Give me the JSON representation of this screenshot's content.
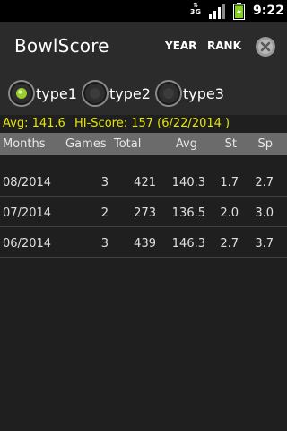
{
  "status_bar": {
    "network": "3G",
    "time": "9:22"
  },
  "action_bar": {
    "title": "BowlScore",
    "year_button": "YEAR",
    "rank_button": "RANK"
  },
  "types": [
    {
      "label": "type1",
      "selected": true
    },
    {
      "label": "type2",
      "selected": false
    },
    {
      "label": "type3",
      "selected": false
    }
  ],
  "summary": {
    "avg_text": "Avg: 141.6",
    "hiscore_text": "HI-Score: 157 (6/22/2014 )"
  },
  "table": {
    "headers": {
      "months": "Months",
      "games": "Games",
      "total": "Total",
      "avg": "Avg",
      "st": "St",
      "sp": "Sp"
    },
    "rows": [
      {
        "month": "08/2014",
        "games": "3",
        "total": "421",
        "avg": "140.3",
        "st": "1.7",
        "sp": "2.7"
      },
      {
        "month": "07/2014",
        "games": "2",
        "total": "273",
        "avg": "136.5",
        "st": "2.0",
        "sp": "3.0"
      },
      {
        "month": "06/2014",
        "games": "3",
        "total": "439",
        "avg": "146.3",
        "st": "2.7",
        "sp": "3.7"
      }
    ]
  },
  "colors": {
    "background": "#1f1f1f",
    "bar": "#2b2b2b",
    "header": "#6b6b6b",
    "summary_text": "#e6e600",
    "radio_selected": "#9acd32"
  }
}
